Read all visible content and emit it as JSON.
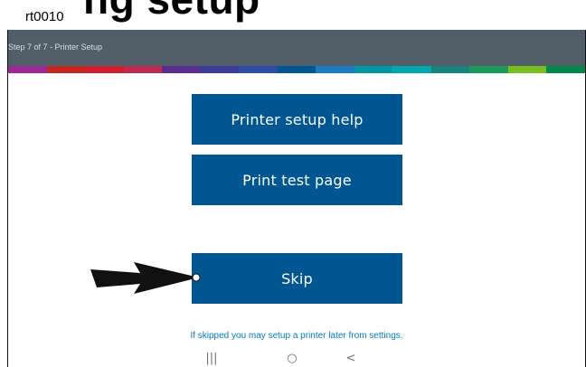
{
  "document": {
    "label": "rt0010",
    "heading_fragment": "ng setup"
  },
  "header": {
    "step_title": "Step 7 of 7 - Printer Setup",
    "bar_color": "#525f69"
  },
  "brand_stripe": [
    "#9e2896",
    "#c4271e",
    "#d0202f",
    "#bf2a4f",
    "#5c2d91",
    "#3b3c99",
    "#2b4da4",
    "#005691",
    "#1d7cc2",
    "#0097a7",
    "#00a8b0",
    "#18837e",
    "#1c9a5a",
    "#78be20",
    "#00884a"
  ],
  "buttons": {
    "help_label": "Printer setup help",
    "test_label": "Print test page",
    "skip_label": "Skip",
    "color": "#005691"
  },
  "hint": {
    "text": "If skipped you may  setup a printer later from settings.",
    "color": "#007bc0"
  },
  "nav": {
    "recents": "|||",
    "home": "○",
    "back": "<"
  }
}
